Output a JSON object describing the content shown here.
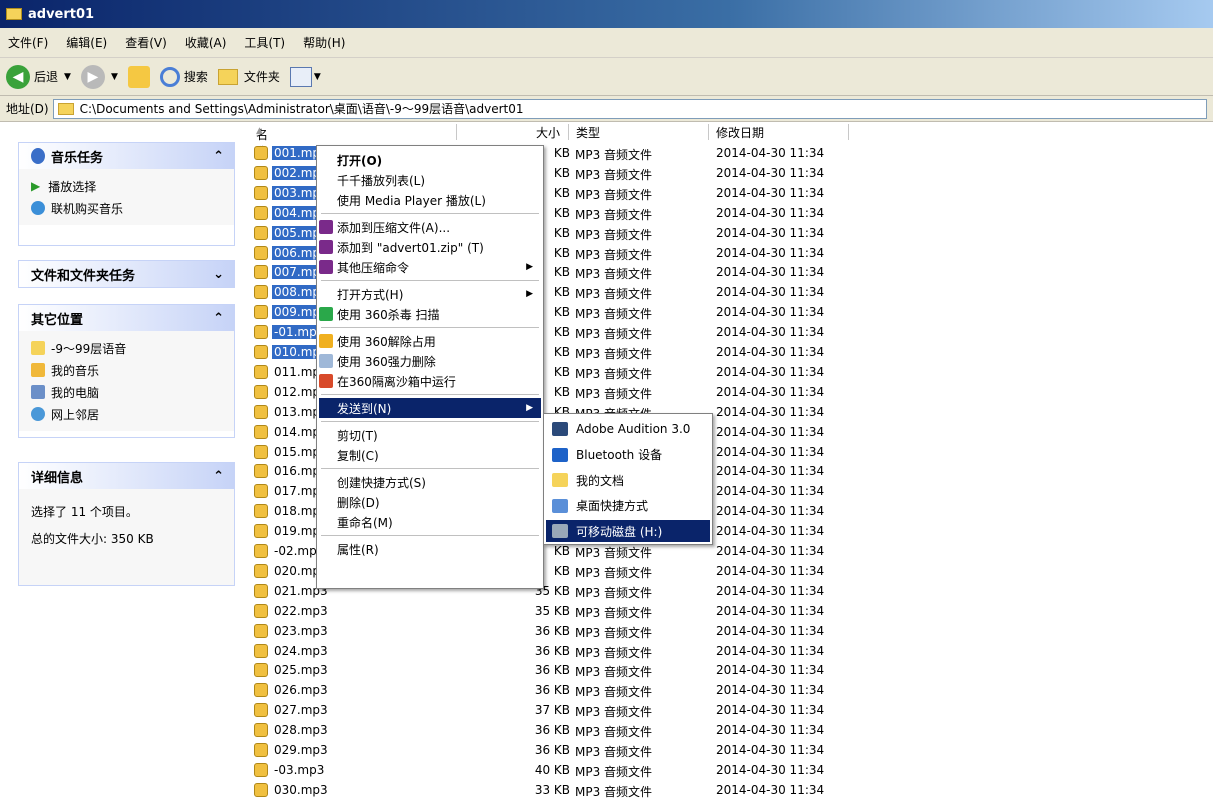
{
  "window": {
    "title": "advert01"
  },
  "menubar": [
    "文件(F)",
    "编辑(E)",
    "查看(V)",
    "收藏(A)",
    "工具(T)",
    "帮助(H)"
  ],
  "toolbar": {
    "back": "后退",
    "search": "搜索",
    "folders": "文件夹"
  },
  "address": {
    "label": "地址(D)",
    "path": "C:\\Documents and Settings\\Administrator\\桌面\\语音\\-9～99层语音\\advert01"
  },
  "left": {
    "music_tasks": {
      "title": "音乐任务",
      "items": [
        "播放选择",
        "联机购买音乐"
      ]
    },
    "file_tasks": {
      "title": "文件和文件夹任务"
    },
    "other_places": {
      "title": "其它位置",
      "items": [
        "-9～99层语音",
        "我的音乐",
        "我的电脑",
        "网上邻居"
      ]
    },
    "details": {
      "title": "详细信息",
      "line1": "选择了 11 个项目。",
      "line2": "总的文件大小: 350 KB"
    }
  },
  "columns": {
    "name": "名称",
    "size": "大小",
    "type": "类型",
    "modified": "修改日期"
  },
  "files": [
    {
      "name": "001.mp",
      "size": "KB",
      "type": "MP3 音频文件",
      "date": "2014-04-30 11:34",
      "sel": true
    },
    {
      "name": "002.mp",
      "size": "KB",
      "type": "MP3 音频文件",
      "date": "2014-04-30 11:34",
      "sel": true
    },
    {
      "name": "003.mp",
      "size": "KB",
      "type": "MP3 音频文件",
      "date": "2014-04-30 11:34",
      "sel": true
    },
    {
      "name": "004.mp",
      "size": "KB",
      "type": "MP3 音频文件",
      "date": "2014-04-30 11:34",
      "sel": true
    },
    {
      "name": "005.mp",
      "size": "KB",
      "type": "MP3 音频文件",
      "date": "2014-04-30 11:34",
      "sel": true
    },
    {
      "name": "006.mp",
      "size": "KB",
      "type": "MP3 音频文件",
      "date": "2014-04-30 11:34",
      "sel": true
    },
    {
      "name": "007.mp",
      "size": "KB",
      "type": "MP3 音频文件",
      "date": "2014-04-30 11:34",
      "sel": true
    },
    {
      "name": "008.mp",
      "size": "KB",
      "type": "MP3 音频文件",
      "date": "2014-04-30 11:34",
      "sel": true
    },
    {
      "name": "009.mp",
      "size": "KB",
      "type": "MP3 音频文件",
      "date": "2014-04-30 11:34",
      "sel": true
    },
    {
      "name": "-01.mp",
      "size": "KB",
      "type": "MP3 音频文件",
      "date": "2014-04-30 11:34",
      "sel": true
    },
    {
      "name": "010.mp",
      "size": "KB",
      "type": "MP3 音频文件",
      "date": "2014-04-30 11:34",
      "sel": true
    },
    {
      "name": "011.mp",
      "size": "KB",
      "type": "MP3 音频文件",
      "date": "2014-04-30 11:34",
      "sel": false
    },
    {
      "name": "012.mp",
      "size": "KB",
      "type": "MP3 音频文件",
      "date": "2014-04-30 11:34",
      "sel": false
    },
    {
      "name": "013.mp",
      "size": "KB",
      "type": "MP3 音频文件",
      "date": "2014-04-30 11:34",
      "sel": false
    },
    {
      "name": "014.mp",
      "size": "KB",
      "type": "MP3 音频文件",
      "date": "2014-04-30 11:34",
      "sel": false
    },
    {
      "name": "015.mp",
      "size": "KB",
      "type": "MP3 音频文件",
      "date": "2014-04-30 11:34",
      "sel": false
    },
    {
      "name": "016.mp",
      "size": "KB",
      "type": "MP3 音频文件",
      "date": "2014-04-30 11:34",
      "sel": false
    },
    {
      "name": "017.mp",
      "size": "KB",
      "type": "MP3 音频文件",
      "date": "2014-04-30 11:34",
      "sel": false
    },
    {
      "name": "018.mp",
      "size": "KB",
      "type": "MP3 音频文件",
      "date": "2014-04-30 11:34",
      "sel": false
    },
    {
      "name": "019.mp",
      "size": "KB",
      "type": "MP3 音频文件",
      "date": "2014-04-30 11:34",
      "sel": false
    },
    {
      "name": "-02.mp",
      "size": "KB",
      "type": "MP3 音频文件",
      "date": "2014-04-30 11:34",
      "sel": false
    },
    {
      "name": "020.mp",
      "size": "KB",
      "type": "MP3 音频文件",
      "date": "2014-04-30 11:34",
      "sel": false
    },
    {
      "name": "021.mp3",
      "size": "35 KB",
      "type": "MP3 音频文件",
      "date": "2014-04-30 11:34",
      "sel": false
    },
    {
      "name": "022.mp3",
      "size": "35 KB",
      "type": "MP3 音频文件",
      "date": "2014-04-30 11:34",
      "sel": false
    },
    {
      "name": "023.mp3",
      "size": "36 KB",
      "type": "MP3 音频文件",
      "date": "2014-04-30 11:34",
      "sel": false
    },
    {
      "name": "024.mp3",
      "size": "36 KB",
      "type": "MP3 音频文件",
      "date": "2014-04-30 11:34",
      "sel": false
    },
    {
      "name": "025.mp3",
      "size": "36 KB",
      "type": "MP3 音频文件",
      "date": "2014-04-30 11:34",
      "sel": false
    },
    {
      "name": "026.mp3",
      "size": "36 KB",
      "type": "MP3 音频文件",
      "date": "2014-04-30 11:34",
      "sel": false
    },
    {
      "name": "027.mp3",
      "size": "37 KB",
      "type": "MP3 音频文件",
      "date": "2014-04-30 11:34",
      "sel": false
    },
    {
      "name": "028.mp3",
      "size": "36 KB",
      "type": "MP3 音频文件",
      "date": "2014-04-30 11:34",
      "sel": false
    },
    {
      "name": "029.mp3",
      "size": "36 KB",
      "type": "MP3 音频文件",
      "date": "2014-04-30 11:34",
      "sel": false
    },
    {
      "name": "-03.mp3",
      "size": "40 KB",
      "type": "MP3 音频文件",
      "date": "2014-04-30 11:34",
      "sel": false
    },
    {
      "name": "030.mp3",
      "size": "33 KB",
      "type": "MP3 音频文件",
      "date": "2014-04-30 11:34",
      "sel": false
    }
  ],
  "context_menu": [
    {
      "label": "打开(O)",
      "bold": true
    },
    {
      "label": "千千播放列表(L)"
    },
    {
      "label": "使用 Media Player 播放(L)"
    },
    {
      "sep": true
    },
    {
      "label": "添加到压缩文件(A)...",
      "icon": "winrar-icon"
    },
    {
      "label": "添加到 \"advert01.zip\" (T)",
      "icon": "winrar-icon"
    },
    {
      "label": "其他压缩命令",
      "icon": "winrar-icon",
      "sub": true
    },
    {
      "sep": true
    },
    {
      "label": "打开方式(H)",
      "sub": true
    },
    {
      "label": "使用 360杀毒 扫描",
      "icon": "shield-icon"
    },
    {
      "sep": true
    },
    {
      "label": "使用 360解除占用",
      "icon": "unlock-icon"
    },
    {
      "label": "使用 360强力删除",
      "icon": "trash-icon"
    },
    {
      "label": "在360隔离沙箱中运行",
      "icon": "sandbox-icon"
    },
    {
      "sep": true
    },
    {
      "label": "发送到(N)",
      "sub": true,
      "hl": true
    },
    {
      "sep": true
    },
    {
      "label": "剪切(T)"
    },
    {
      "label": "复制(C)"
    },
    {
      "sep": true
    },
    {
      "label": "创建快捷方式(S)"
    },
    {
      "label": "删除(D)"
    },
    {
      "label": "重命名(M)"
    },
    {
      "sep": true
    },
    {
      "label": "属性(R)"
    }
  ],
  "send_to": [
    {
      "label": "Adobe Audition 3.0",
      "icon": "audition-icon"
    },
    {
      "label": "Bluetooth 设备",
      "icon": "bluetooth-icon"
    },
    {
      "label": "我的文档",
      "icon": "documents-icon"
    },
    {
      "label": "桌面快捷方式",
      "icon": "desktop-icon"
    },
    {
      "label": "可移动磁盘 (H:)",
      "icon": "removable-drive-icon",
      "hl": true
    }
  ]
}
